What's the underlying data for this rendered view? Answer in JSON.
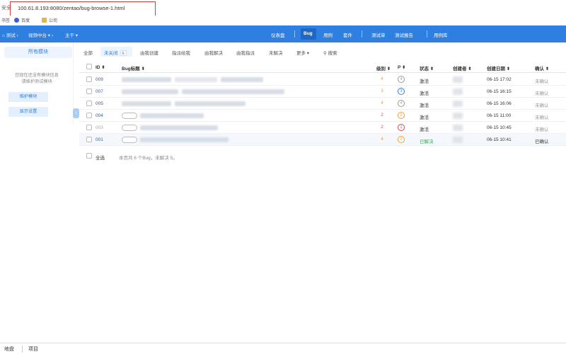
{
  "browser": {
    "secure_label": "安全",
    "url": "100.61.8.193:8080/zentao/bug-browse-1.html",
    "bookmarks_label": "书签",
    "bookmarks": [
      "百度",
      "公司"
    ]
  },
  "topnav": {
    "crumbs": [
      "测试",
      "视频中台",
      "主干"
    ],
    "items": [
      "仪表盘",
      "Bug",
      "用例",
      "套件",
      "测试单",
      "测试报告",
      "用例库"
    ],
    "active": "Bug"
  },
  "sidebar": {
    "title": "所有模块",
    "empty_line1": "您现在还没有模块信息",
    "empty_line2": "请维护测试模块",
    "maintain_button": "维护模块",
    "display_button": "显示设置",
    "toggle_icon": "chevron-left-icon"
  },
  "filters": {
    "all": "全部",
    "unclosed": "未关闭",
    "unclosed_count": "6",
    "created_by_me": "由我创建",
    "assigned_to_me": "指派给我",
    "resolved_by_me": "由我解决",
    "assigned_by_me": "由我指派",
    "unresolved": "未解决",
    "more": "更多",
    "search": "搜索"
  },
  "table": {
    "headers": {
      "id": "ID",
      "title": "Bug标题",
      "severity": "级别",
      "priority": "P",
      "status": "状态",
      "creator": "创建者",
      "date": "创建日期",
      "confirm": "确认"
    },
    "rows": [
      {
        "id": "009",
        "severity": "4",
        "priority": "4",
        "status": "激活",
        "date": "06-15 17:02",
        "confirm": "未确认"
      },
      {
        "id": "007",
        "severity": "3",
        "priority": "3",
        "status": "激活",
        "date": "06-15 16:15",
        "confirm": "未确认"
      },
      {
        "id": "005",
        "severity": "4",
        "priority": "4",
        "status": "激活",
        "date": "06-15 16:06",
        "confirm": "未确认"
      },
      {
        "id": "004",
        "severity": "2",
        "priority": "2",
        "status": "激活",
        "date": "06-15 11:00",
        "confirm": "未确认"
      },
      {
        "id": "003",
        "severity": "2",
        "priority": "1",
        "status": "激活",
        "date": "06-15 10:45",
        "confirm": "未确认"
      },
      {
        "id": "001",
        "severity": "4",
        "priority": "2",
        "status": "已解决",
        "date": "06-15 10:41",
        "confirm": "已确认"
      }
    ],
    "select_all": "全选",
    "summary": "本页共 6 个Bug，未解决 5。"
  },
  "colors": {
    "brand": "#2e7fe0",
    "resolved": "#2fa84f",
    "pri1": "#e04545",
    "pri2": "#f0a030",
    "pri3": "#2e7fe0",
    "pri4": "#999999"
  },
  "bottombar": [
    "地盘",
    "项目"
  ]
}
